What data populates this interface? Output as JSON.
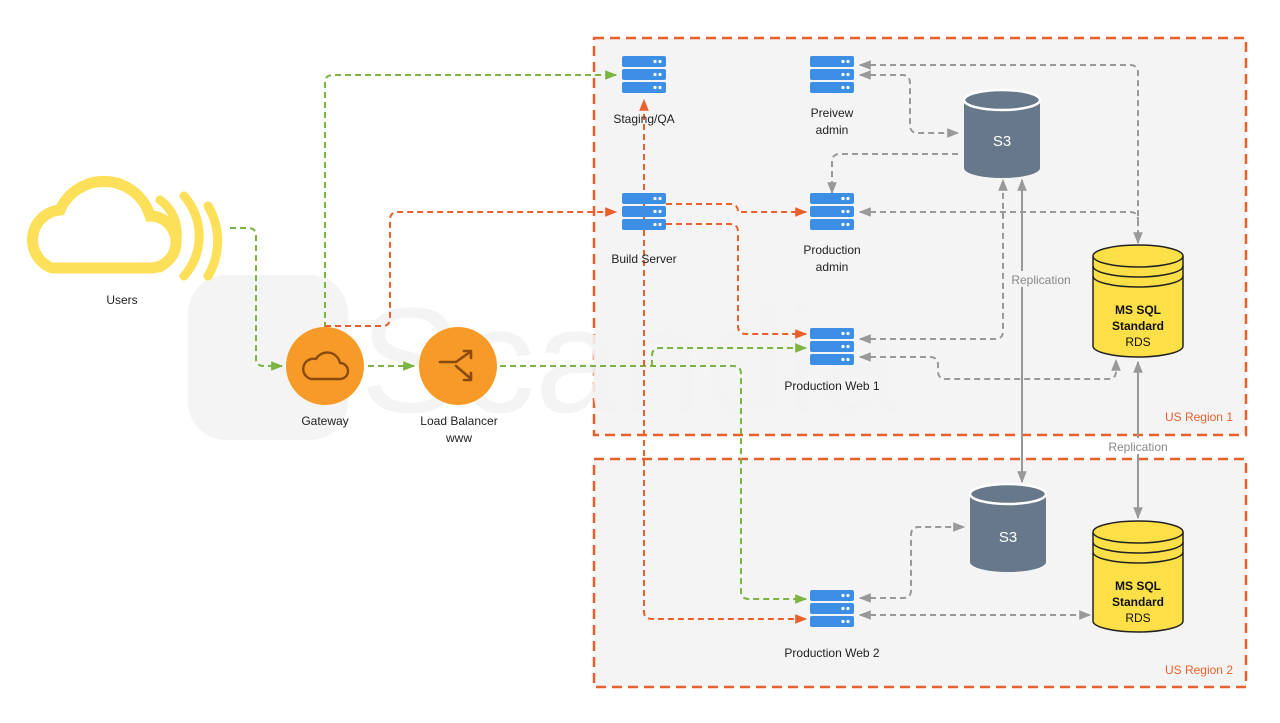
{
  "colors": {
    "orange_flow": "#e8602c",
    "green_flow": "#7cb342",
    "grey_flow": "#999999",
    "region_fill": "#f4f4f4",
    "server_blue": "#3d8fe6",
    "s3_slate": "#66788a",
    "db_yellow": "#fde047",
    "cloud_yellow": "#fde05a",
    "node_orange": "#f79a27"
  },
  "watermark": "Scandia",
  "nodes": {
    "users": {
      "label": "Users",
      "icon": "cloud-signal-icon"
    },
    "gateway": {
      "label": "Gateway",
      "icon": "cloud-icon"
    },
    "load_balancer": {
      "label": "Load Balancer",
      "sublabel": "www",
      "icon": "shuffle-icon"
    },
    "staging": {
      "label": "Staging/QA",
      "icon": "server-icon"
    },
    "build": {
      "label": "Build Server",
      "icon": "server-icon"
    },
    "preview_admin": {
      "label_line1": "Preivew",
      "label_line2": "admin",
      "icon": "server-icon"
    },
    "production_admin": {
      "label_line1": "Production",
      "label_line2": "admin",
      "icon": "server-icon"
    },
    "production_web1": {
      "label": "Production Web 1",
      "icon": "server-icon"
    },
    "production_web2": {
      "label": "Production Web 2",
      "icon": "server-icon"
    },
    "s3_region1": {
      "label": "S3",
      "icon": "storage-cylinder-icon"
    },
    "s3_region2": {
      "label": "S3",
      "icon": "storage-cylinder-icon"
    },
    "db_region1": {
      "line1": "MS SQL",
      "line2": "Standard",
      "line3": "RDS",
      "icon": "database-icon"
    },
    "db_region2": {
      "line1": "MS SQL",
      "line2": "Standard",
      "line3": "RDS",
      "icon": "database-icon"
    }
  },
  "regions": {
    "region1": {
      "label": "US Region 1"
    },
    "region2": {
      "label": "US Region 2"
    }
  },
  "replication": {
    "s3_label": "Replication",
    "db_label": "Replication"
  }
}
